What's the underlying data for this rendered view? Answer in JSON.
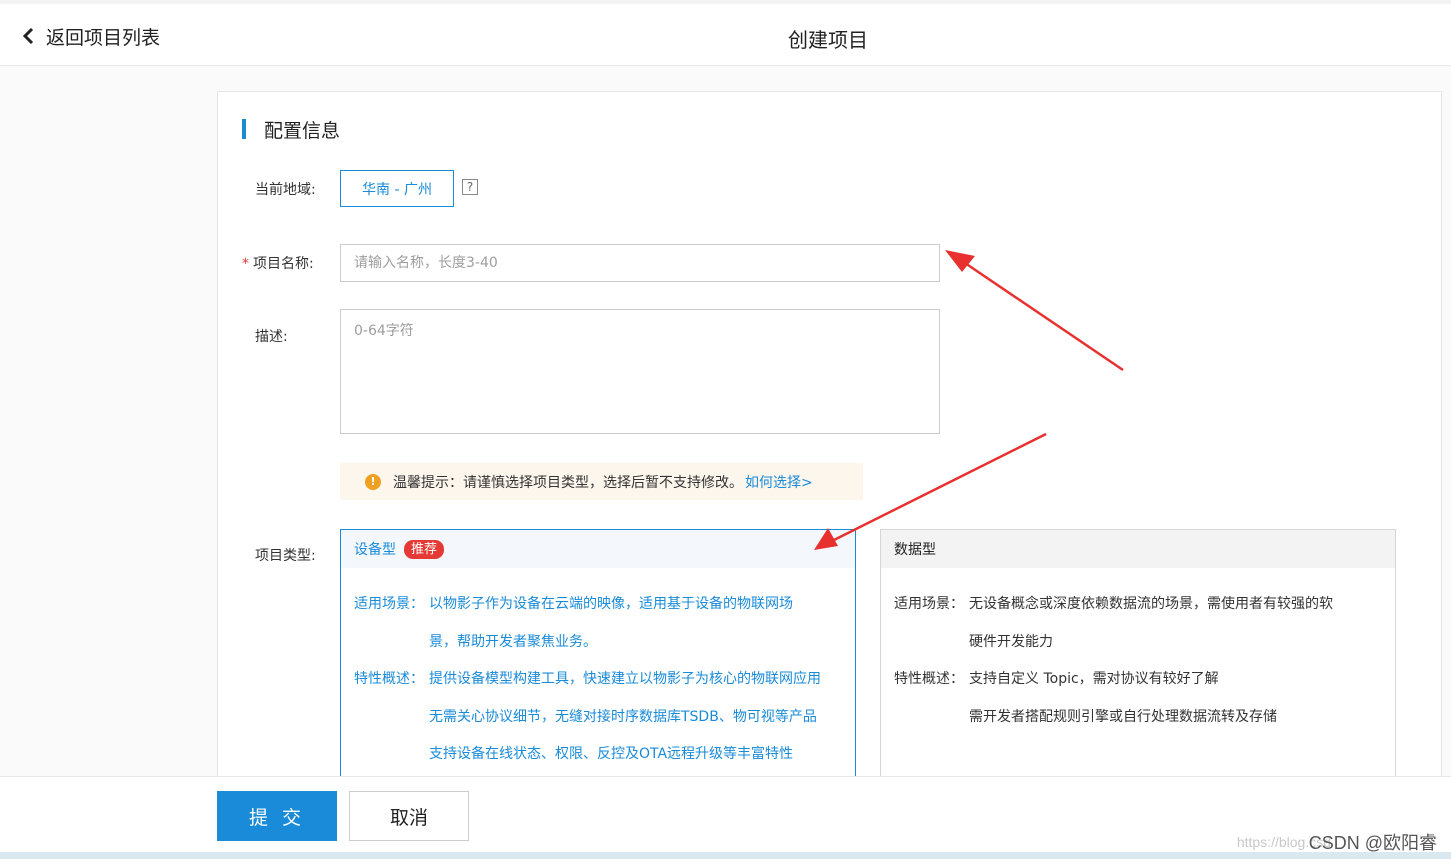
{
  "header": {
    "back_label": "返回项目列表",
    "title": "创建项目"
  },
  "section": {
    "title": "配置信息"
  },
  "form": {
    "region_label": "当前地域:",
    "region_value": "华南 - 广州",
    "help_glyph": "?",
    "required_mark": "*",
    "name_label": "项目名称:",
    "name_placeholder": "请输入名称，长度3-40",
    "name_value": "",
    "desc_label": "描述:",
    "desc_placeholder": "0-64字符",
    "desc_value": "",
    "type_label": "项目类型:"
  },
  "tip": {
    "icon_glyph": "!",
    "text": "温馨提示：请谨慎选择项目类型，选择后暂不支持修改。",
    "link": "如何选择>"
  },
  "cards": {
    "device": {
      "title": "设备型",
      "badge": "推荐",
      "scene_key": "适用场景：",
      "scene_lines": [
        "以物影子作为设备在云端的映像，适用基于设备的物联网场",
        "景，帮助开发者聚焦业务。"
      ],
      "feature_key": "特性概述：",
      "feature_lines": [
        "提供设备模型构建工具，快速建立以物影子为核心的物联网应用",
        "无需关心协议细节，无缝对接时序数据库TSDB、物可视等产品",
        "支持设备在线状态、权限、反控及OTA远程升级等丰富特性"
      ]
    },
    "data": {
      "title": "数据型",
      "scene_key": "适用场景：",
      "scene_lines": [
        "无设备概念或深度依赖数据流的场景，需使用者有较强的软",
        "硬件开发能力"
      ],
      "feature_key": "特性概述：",
      "feature_lines": [
        "支持自定义 Topic，需对协议有较好了解",
        "需开发者搭配规则引擎或自行处理数据流转及存储"
      ]
    }
  },
  "footer": {
    "submit": "提 交",
    "cancel": "取消"
  },
  "watermark": {
    "faint": "https://blog.csd",
    "text": "CSDN @欧阳睿"
  },
  "colors": {
    "accent": "#1a8bd8",
    "badge": "#e53935",
    "warning": "#f0a020",
    "annotation_arrow": "#e8312e"
  }
}
